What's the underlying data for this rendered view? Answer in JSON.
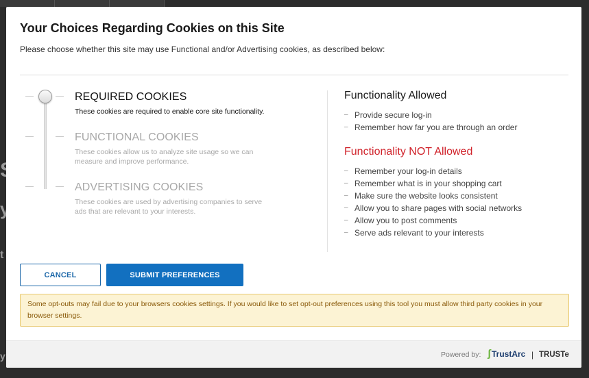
{
  "dialog": {
    "title": "Your Choices Regarding Cookies on this Site",
    "subtitle": "Please choose whether this site may use Functional and/or Advertising cookies, as described below:"
  },
  "categories": [
    {
      "title": "REQUIRED COOKIES",
      "description": "These cookies are required to enable core site functionality.",
      "selected": true
    },
    {
      "title": "FUNCTIONAL COOKIES",
      "description": "These cookies allow us to analyze site usage so we can measure and improve performance.",
      "selected": false
    },
    {
      "title": "ADVERTISING COOKIES",
      "description": "These cookies are used by advertising companies to serve ads that are relevant to your interests.",
      "selected": false
    }
  ],
  "allowed": {
    "heading": "Functionality Allowed",
    "items": [
      "Provide secure log-in",
      "Remember how far you are through an order"
    ]
  },
  "not_allowed": {
    "heading": "Functionality NOT Allowed",
    "items": [
      "Remember your log-in details",
      "Remember what is in your shopping cart",
      "Make sure the website looks consistent",
      "Allow you to share pages with social networks",
      "Allow you to post comments",
      "Serve ads relevant to your interests"
    ]
  },
  "buttons": {
    "cancel": "CANCEL",
    "submit": "SUBMIT PREFERENCES"
  },
  "warning": "Some opt-outs may fail due to your browsers cookies settings. If you would like to set opt-out preferences using this tool you must allow third party cookies in your browser settings.",
  "footer": {
    "powered_by": "Powered by:",
    "brand1": "TrustArc",
    "separator": "|",
    "brand2": "TRUSTe"
  },
  "colors": {
    "accent": "#1270c0",
    "not_allowed": "#d0222a",
    "warning_bg": "#fcf3d4"
  },
  "backdrop": {
    "glyphs": [
      "S",
      "y",
      "t",
      "y"
    ]
  }
}
